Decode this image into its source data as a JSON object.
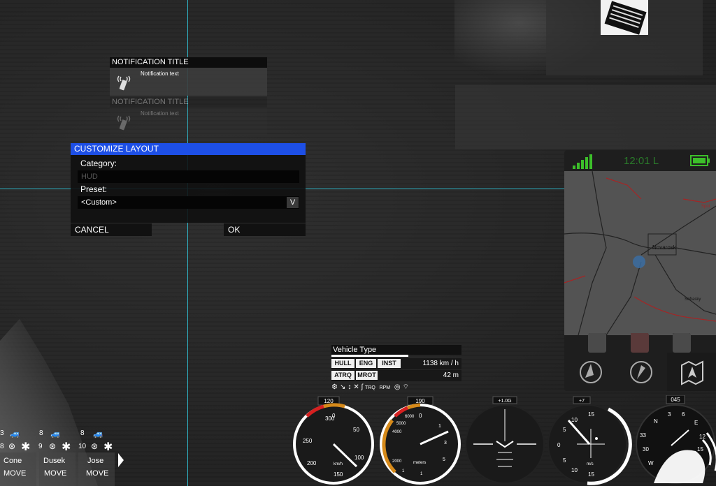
{
  "notifications": [
    {
      "title": "NOTIFICATION TITLE",
      "text": "Notification text"
    },
    {
      "title": "NOTIFICATION TITLE",
      "text": "Notification text"
    }
  ],
  "dialog": {
    "title": "CUSTOMIZE LAYOUT",
    "category_label": "Category:",
    "category_value": "HUD",
    "preset_label": "Preset:",
    "preset_value": "<Custom>",
    "dropdown_glyph": "V",
    "cancel_label": "CANCEL",
    "ok_label": "OK"
  },
  "phone": {
    "clock": "12:01 L",
    "town_label": "Novarosk",
    "small_label": "Sofrasky",
    "corner_label": "Spol"
  },
  "vehicle": {
    "type_label": "Vehicle Type",
    "chips_row1": [
      "HULL",
      "ENG",
      "INST"
    ],
    "chips_row2": [
      "ATRQ",
      "MROT"
    ],
    "speed": "1138 km / h",
    "altitude": "42 m",
    "trq": "TRQ",
    "rpm": "RPM"
  },
  "gauges": {
    "speed_top": "120",
    "speed_ticks": [
      "300",
      "0",
      "50",
      "250",
      "100",
      "200",
      "150"
    ],
    "speed_unit": "km/h",
    "alt_top": "190",
    "alt_ticks": [
      "6000",
      "0",
      "5000",
      "1",
      "4000",
      "3",
      "2000",
      "5",
      "meters",
      "1",
      "1"
    ],
    "gforce": "+1.0G",
    "vs_top": "+7",
    "vs_ticks": [
      "15",
      "10",
      "5",
      "0",
      "5",
      "10",
      "15"
    ],
    "vs_unit": "m/s",
    "heading": "045",
    "compass_ticks": [
      "N",
      "3",
      "6",
      "E",
      "12",
      "15",
      "33",
      "30",
      "W"
    ]
  },
  "squad": {
    "counts_top": [
      "3",
      "8",
      "8"
    ],
    "counts_bottom": [
      "8",
      "9",
      "10"
    ],
    "members": [
      {
        "name": "Cone",
        "order": "MOVE"
      },
      {
        "name": "Dusek",
        "order": "MOVE"
      },
      {
        "name": "Jose",
        "order": "MOVE"
      }
    ]
  },
  "colors": {
    "dialog_header": "#1d4fe6",
    "guide_line": "#2fb6c8",
    "phone_signal": "#3cbf2a",
    "gauge_warn": "#d68a1a",
    "gauge_danger": "#d62020"
  }
}
